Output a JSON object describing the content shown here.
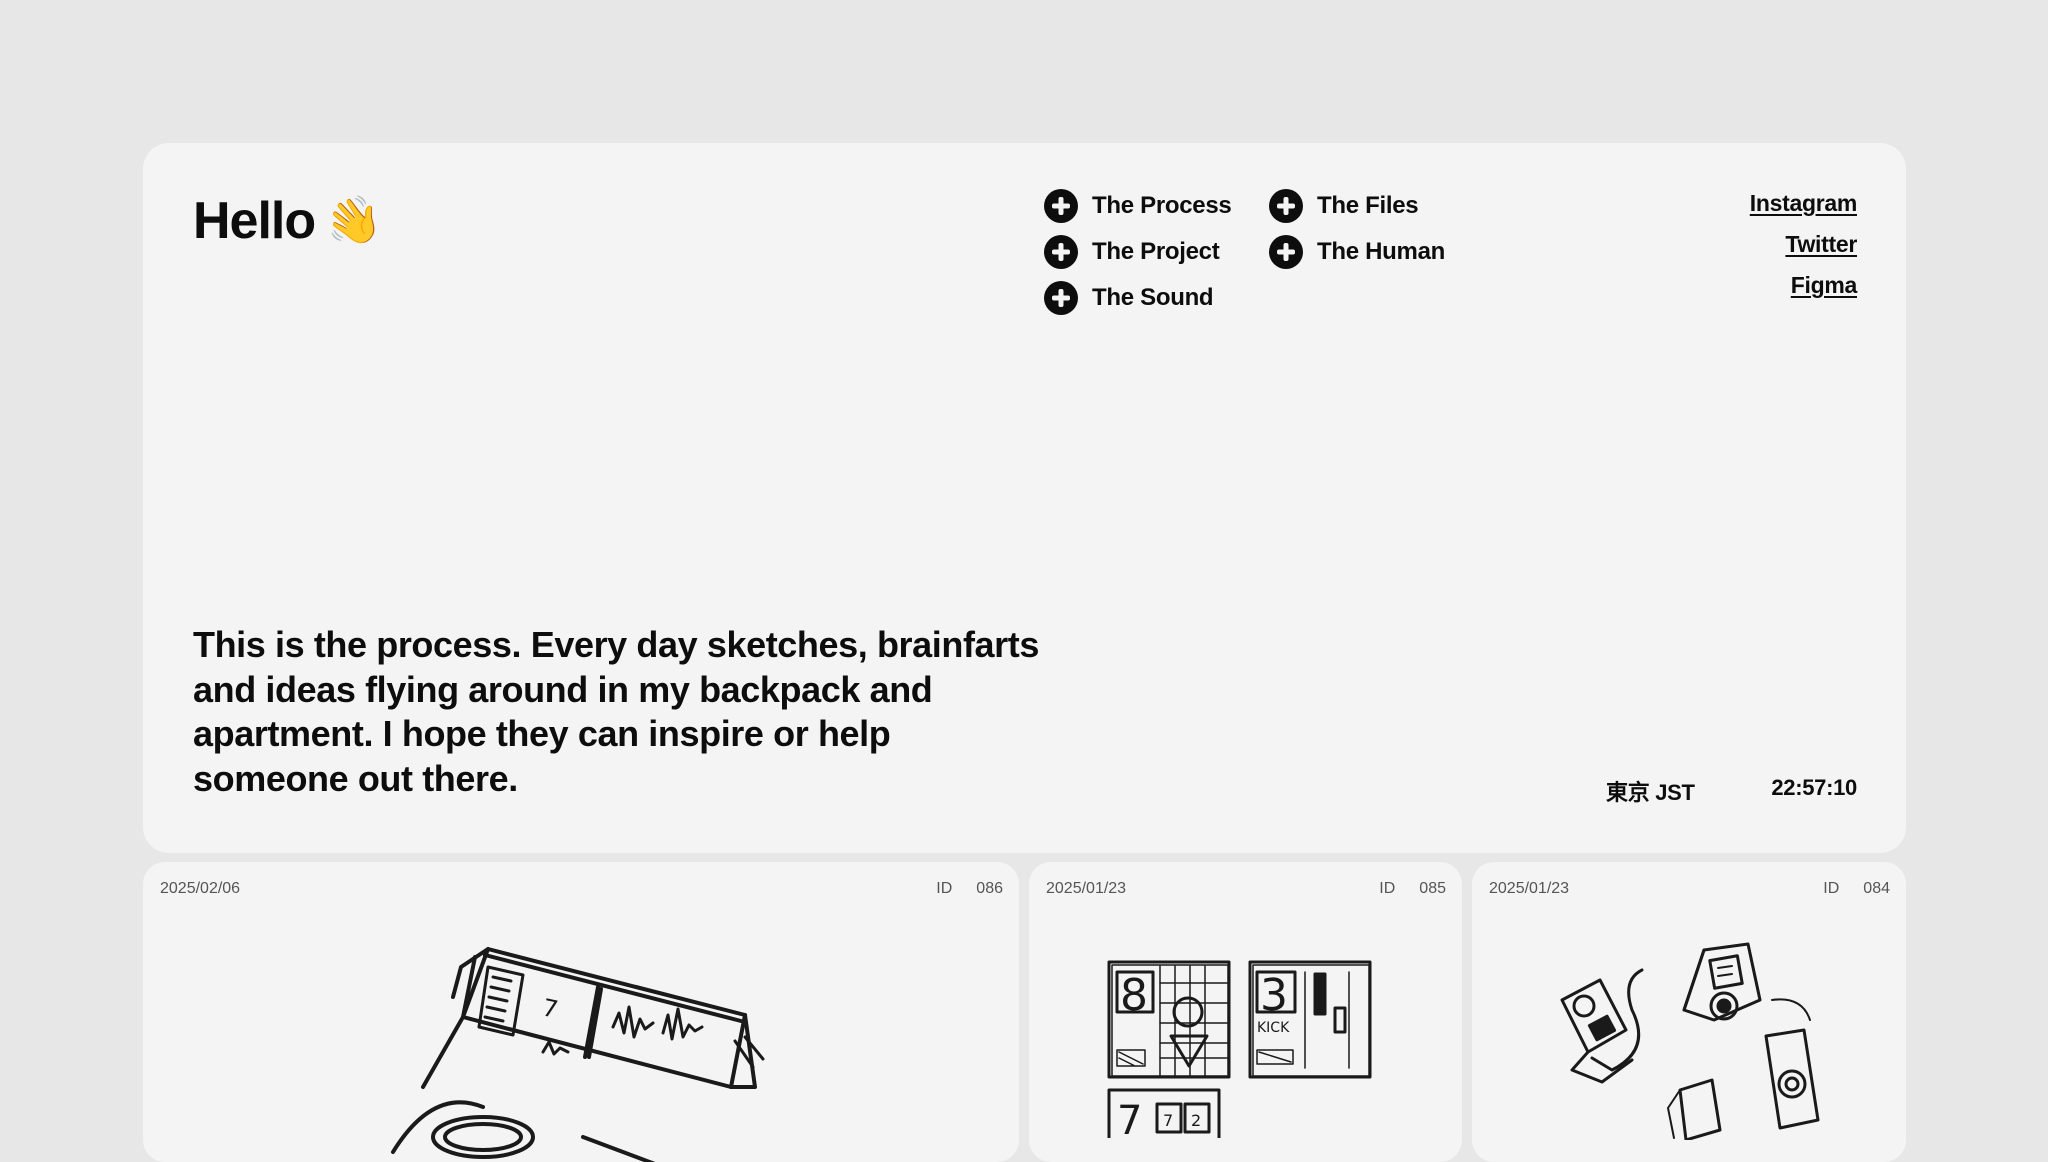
{
  "hero": {
    "greeting": "Hello",
    "greeting_emoji": "👋",
    "intro": "This is the process. Every day sketches, brainfarts and ideas flying around in my backpack and apartment. I hope they can inspire or help someone out there.",
    "timezone": "東京 JST",
    "time": "22:57:10"
  },
  "nav": {
    "items": [
      {
        "label": "The Process"
      },
      {
        "label": "The Files"
      },
      {
        "label": "The Project"
      },
      {
        "label": "The Human"
      },
      {
        "label": "The Sound"
      }
    ]
  },
  "social": {
    "links": [
      {
        "label": "Instagram"
      },
      {
        "label": "Twitter"
      },
      {
        "label": "Figma"
      }
    ]
  },
  "cards": [
    {
      "date": "2025/02/06",
      "id_label": "ID",
      "id": "086",
      "sketch": "sampler-device-sketch"
    },
    {
      "date": "2025/01/23",
      "id_label": "ID",
      "id": "085",
      "sketch": "drum-pad-grid-sketch"
    },
    {
      "date": "2025/01/23",
      "id_label": "ID",
      "id": "084",
      "sketch": "gadgets-sketch"
    }
  ],
  "sketch_labels": {
    "pad_a": "8",
    "pad_b": "3",
    "pad_b_caption": "KICK",
    "pad_c": "7",
    "pad_c_key_1": "7",
    "pad_c_key_2": "2",
    "device_marker": "7"
  },
  "colors": {
    "page_background": "#e7e7e7",
    "panel_background": "#f4f4f4",
    "text": "#0d0d0d"
  }
}
